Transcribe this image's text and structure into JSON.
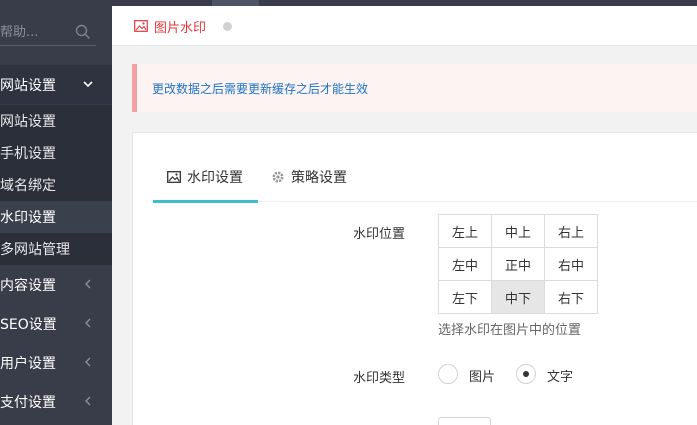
{
  "sidebar": {
    "search_placeholder": "帮助...",
    "groups": [
      {
        "label": "网站设置",
        "open": true
      },
      {
        "label": "内容设置"
      },
      {
        "label": "SEO设置"
      },
      {
        "label": "用户设置"
      },
      {
        "label": "支付设置"
      }
    ],
    "subitems": [
      "网站设置",
      "手机设置",
      "域名绑定",
      "水印设置",
      "多网站管理"
    ],
    "active_sub": "水印设置"
  },
  "header": {
    "tab_title": "图片水印"
  },
  "alert": {
    "text": "更改数据之后需要更新缓存之后才能生效"
  },
  "tabs": [
    {
      "label": "水印设置",
      "icon": "image-icon",
      "active": true
    },
    {
      "label": "策略设置",
      "icon": "gear-icon"
    }
  ],
  "form": {
    "position_label": "水印位置",
    "positions": [
      [
        "左上",
        "中上",
        "右上"
      ],
      [
        "左中",
        "正中",
        "右中"
      ],
      [
        "左下",
        "中下",
        "右下"
      ]
    ],
    "selected_position": "中下",
    "position_hint": "选择水印在图片中的位置",
    "type_label": "水印类型",
    "type_options": [
      "图片",
      "文字"
    ],
    "selected_type": "文字"
  },
  "colors": {
    "sidebar_bg": "#393d49",
    "accent_tab": "#3cbfc9",
    "header_title": "#e4393c",
    "alert_text": "#1e74c5"
  }
}
